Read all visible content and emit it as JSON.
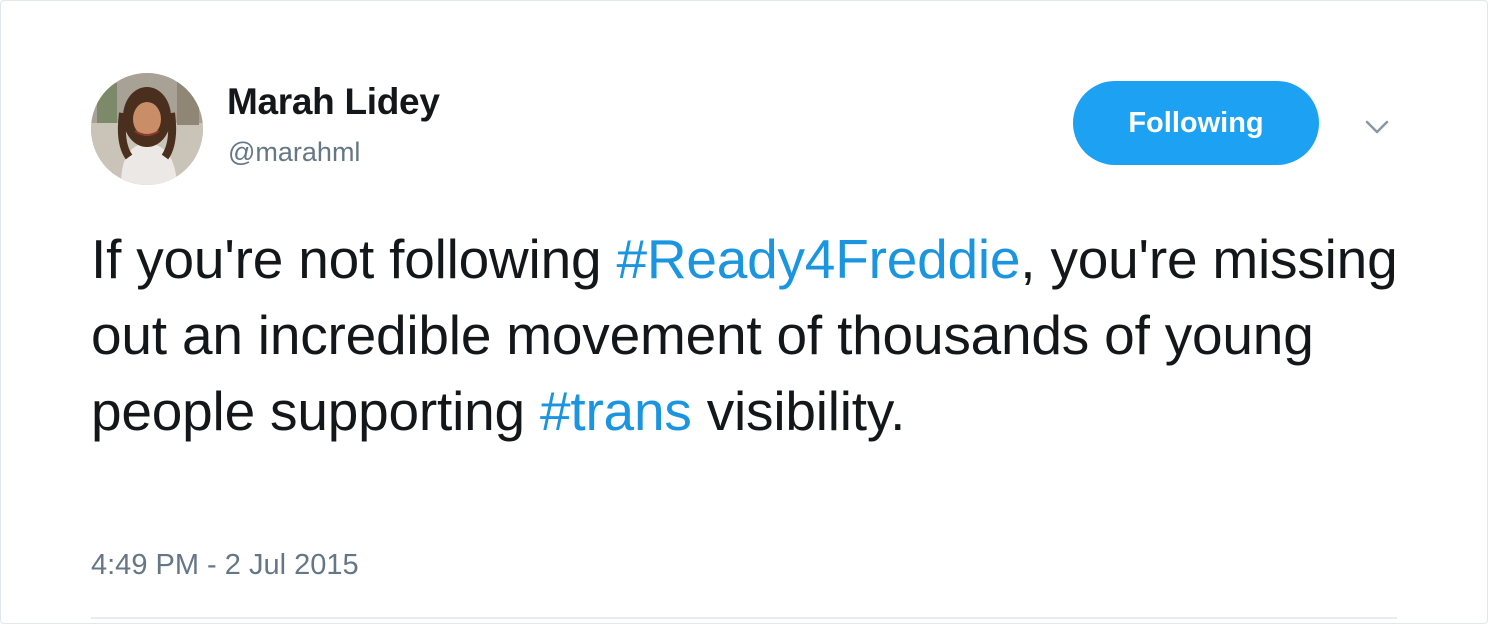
{
  "user": {
    "display_name": "Marah Lidey",
    "handle": "@marahml"
  },
  "follow_button": {
    "label": "Following"
  },
  "tweet": {
    "segments": [
      {
        "type": "text",
        "value": "If you're not following "
      },
      {
        "type": "hashtag",
        "value": "#Ready4Freddie"
      },
      {
        "type": "text",
        "value": ", you're missing out an incredible movement of thousands of young people supporting "
      },
      {
        "type": "hashtag",
        "value": "#trans"
      },
      {
        "type": "text",
        "value": " visibility."
      }
    ],
    "timestamp": "4:49 PM - 2 Jul 2015"
  },
  "icons": {
    "caret": "chevron-down-icon",
    "avatar": "profile-photo"
  },
  "colors": {
    "accent": "#1da1f2",
    "link": "#1b95e0",
    "text": "#14171a",
    "secondary": "#657786"
  }
}
